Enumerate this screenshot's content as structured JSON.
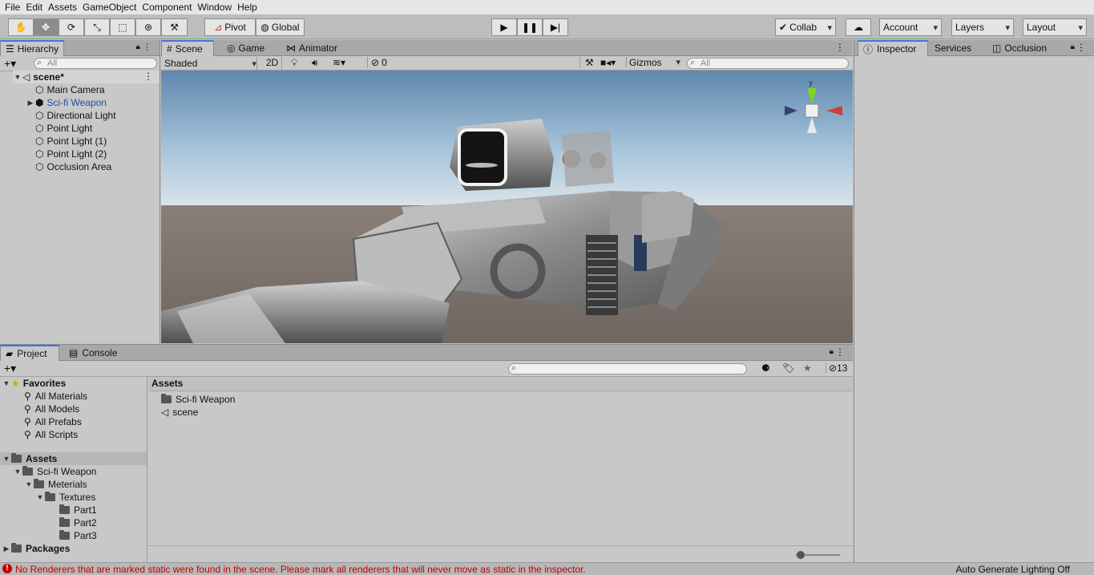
{
  "menu": {
    "items": [
      "File",
      "Edit",
      "Assets",
      "GameObject",
      "Component",
      "Window",
      "Help"
    ]
  },
  "toolbar": {
    "pivot": "Pivot",
    "global": "Global",
    "collab": "Collab",
    "account": "Account",
    "layers": "Layers",
    "layout": "Layout"
  },
  "hierarchy": {
    "tab": "Hierarchy",
    "search_placeholder": "All",
    "scene": "scene*",
    "items": [
      "Main Camera",
      "Sci-fi Weapon",
      "Directional Light",
      "Point Light",
      "Point Light (1)",
      "Point Light (2)",
      "Occlusion Area"
    ]
  },
  "scene": {
    "tabs": [
      "Scene",
      "Game",
      "Animator"
    ],
    "shading": "Shaded",
    "mode_2d": "2D",
    "hidden_count": "0",
    "gizmos": "Gizmos",
    "search_placeholder": "All",
    "axis_y": "y"
  },
  "inspector": {
    "tabs": [
      "Inspector",
      "Services",
      "Occlusion"
    ]
  },
  "project": {
    "tabs": [
      "Project",
      "Console"
    ],
    "favorites_label": "Favorites",
    "favorites": [
      "All Materials",
      "All Models",
      "All Prefabs",
      "All Scripts"
    ],
    "assets_label": "Assets",
    "tree": [
      "Sci-fi Weapon",
      "Meterials",
      "Textures",
      "Part1",
      "Part2",
      "Part3"
    ],
    "packages_label": "Packages",
    "breadcrumb": "Assets",
    "files": [
      "Sci-fi Weapon",
      "scene"
    ],
    "hidden_count": "13",
    "zoom": 0.1
  },
  "status": {
    "message": "No Renderers that are marked static were found in the scene. Please mark all renderers that will never move as static in the inspector.",
    "lighting": "Auto Generate Lighting Off"
  },
  "colors": {
    "accent": "#3a79d8",
    "selected_text": "#1f4fa8",
    "error": "#c00000"
  }
}
